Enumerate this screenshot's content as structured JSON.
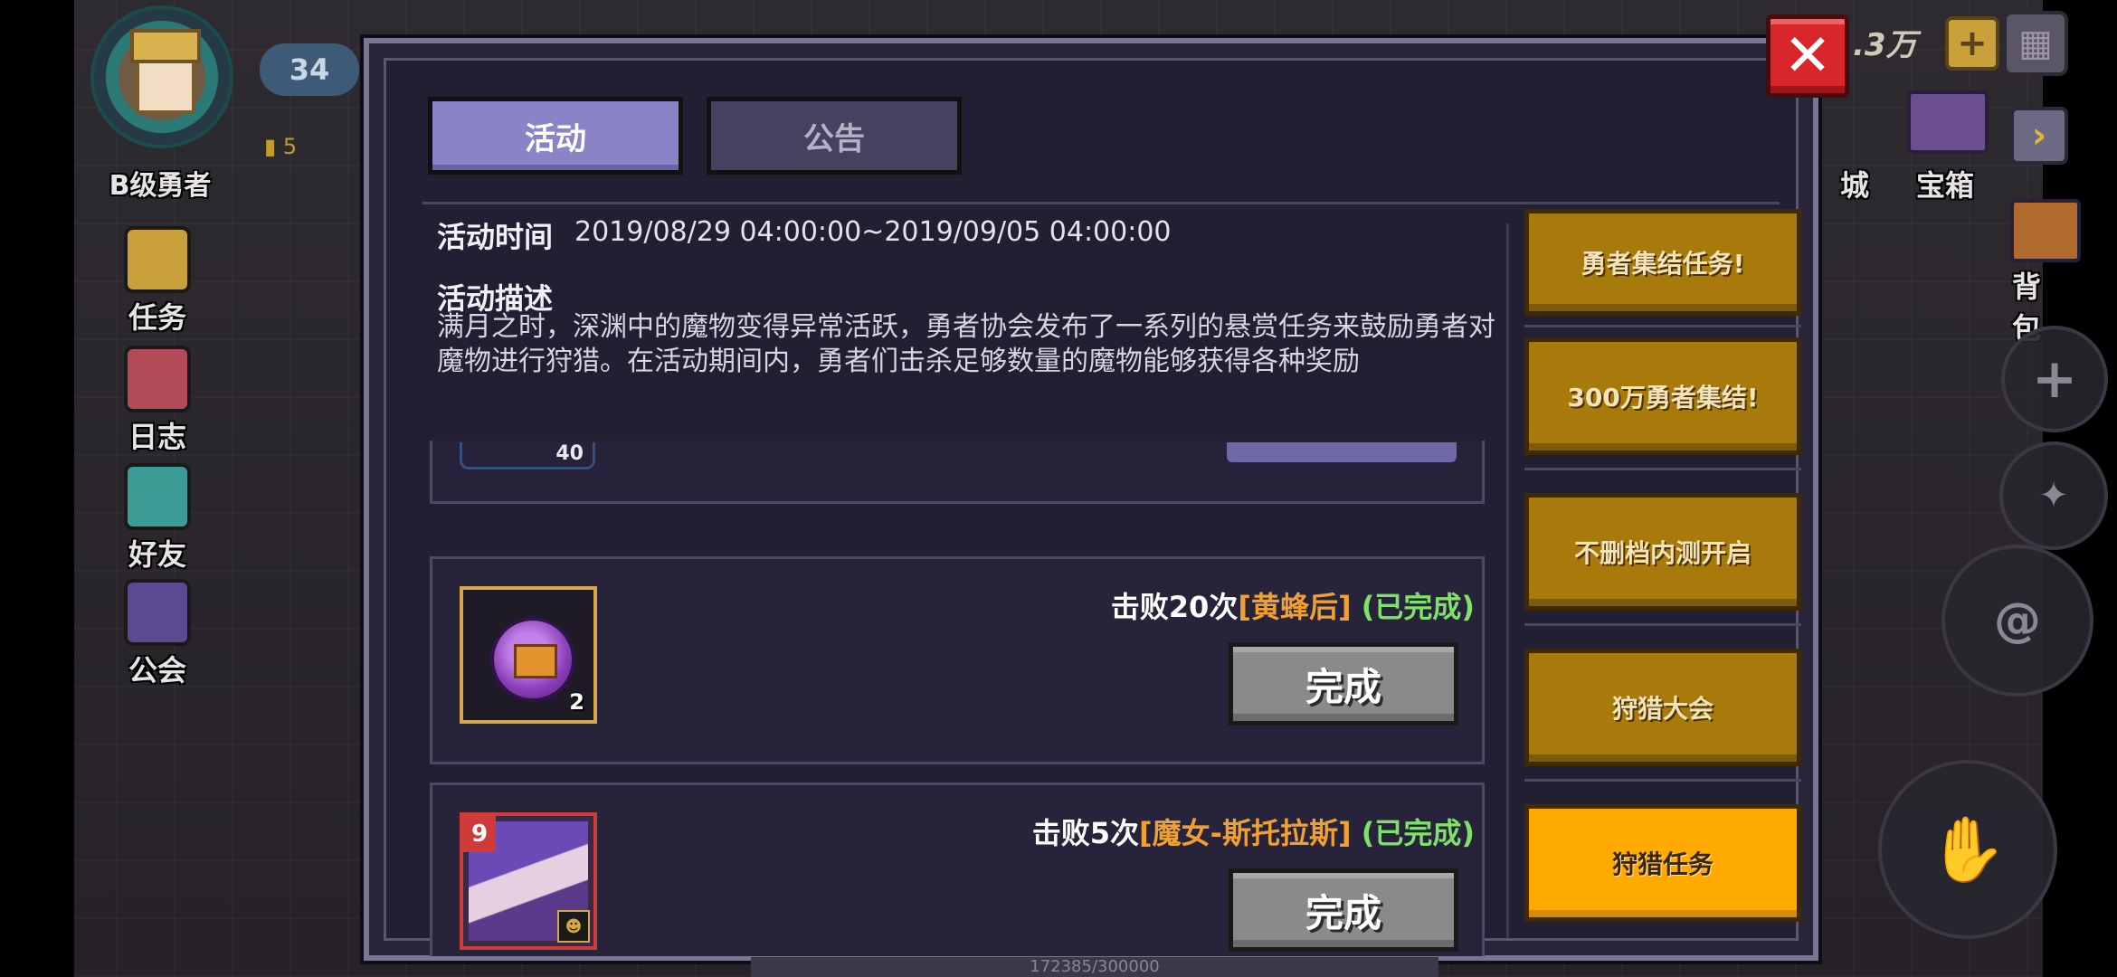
{
  "hud_left": {
    "level": "34",
    "rank": "B级勇者",
    "mini_count": "5",
    "buttons": [
      {
        "label": "任务",
        "icon": "exclamation-icon"
      },
      {
        "label": "日志",
        "icon": "journal-icon"
      },
      {
        "label": "好友",
        "icon": "friend-icon"
      },
      {
        "label": "公会",
        "icon": "guild-banner-icon"
      }
    ]
  },
  "hud_right": {
    "currency": ".3万",
    "plus": "+",
    "city_label": "城",
    "chest_label": "宝箱",
    "bag_label": "背包"
  },
  "dialog": {
    "tabs": [
      {
        "label": "活动",
        "active": true
      },
      {
        "label": "公告",
        "active": false
      }
    ],
    "event_time_label": "活动时间",
    "event_time_value": "2019/08/29 04:00:00~2019/09/05 04:00:00",
    "description_label": "活动描述",
    "description_text": "满月之时，深渊中的魔物变得异常活跃，勇者协会发布了一系列的悬赏任务来鼓励勇者对魔物进行狩猎。在活动期间内，勇者们击杀足够数量的魔物能够获得各种奖励",
    "cut_card_count": "40",
    "quests": [
      {
        "prefix": "击败20次",
        "target": "[黄蜂后]",
        "status": "(已完成)",
        "reward_count": "2",
        "reward_icon": "treasure-chest-orb-icon",
        "button": "完成"
      },
      {
        "prefix": "击败5次",
        "target": "[魔女-斯托拉斯]",
        "status": "(已完成)",
        "reward_level": "9",
        "reward_icon": "witch-portrait-icon",
        "button": "完成"
      }
    ],
    "side_tabs": [
      {
        "label": "勇者集结任务!",
        "active": false
      },
      {
        "label": "300万勇者集结!",
        "active": false
      },
      {
        "label": "不删档内测开启",
        "active": false
      },
      {
        "label": "狩猎大会",
        "active": false
      },
      {
        "label": "狩猎任务",
        "active": true
      }
    ],
    "close": "✕"
  },
  "bottom_bar": "172385/300000",
  "colors": {
    "accent_tab": "#8a83c7",
    "side_tab": "#a87a0c",
    "side_tab_active": "#ffaa00",
    "target_text": "#f0a030",
    "status_text": "#7fe06a",
    "close_button": "#d8262a"
  }
}
